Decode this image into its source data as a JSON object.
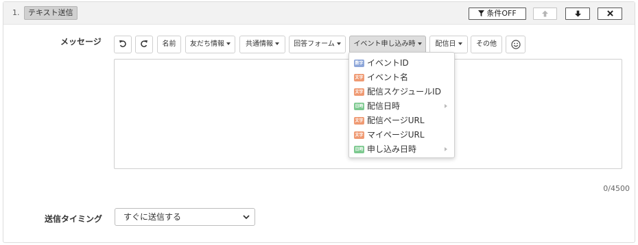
{
  "step": {
    "number": "1.",
    "title": "テキスト送信"
  },
  "header_buttons": {
    "condition_label": "条件OFF",
    "move_up_label": "🡅",
    "move_down_label": "🡇",
    "delete_label": "✖"
  },
  "message": {
    "label": "メッセージ",
    "toolbar": {
      "undo_icon": "undo-icon",
      "redo_icon": "redo-icon",
      "name": "名前",
      "friend_info": "友だち情報",
      "common_info": "共通情報",
      "answer_form": "回答フォーム",
      "event_application": "イベント申し込み時",
      "delivery_date": "配信日",
      "other": "その他",
      "emoji_icon": "smile-icon"
    },
    "editor_value": "",
    "counter": "0/4500"
  },
  "dropdown": {
    "items": [
      {
        "tag": "数字",
        "tag_color": "#8da6d9",
        "label": "イベントID",
        "has_submenu": false
      },
      {
        "tag": "文字",
        "tag_color": "#ef9a73",
        "label": "イベント名",
        "has_submenu": false
      },
      {
        "tag": "文字",
        "tag_color": "#ef9a73",
        "label": "配信スケジュールID",
        "has_submenu": false
      },
      {
        "tag": "日時",
        "tag_color": "#7cc98f",
        "label": "配信日時",
        "has_submenu": true
      },
      {
        "tag": "文字",
        "tag_color": "#ef9a73",
        "label": "配信ページURL",
        "has_submenu": false
      },
      {
        "tag": "文字",
        "tag_color": "#ef9a73",
        "label": "マイページURL",
        "has_submenu": false
      },
      {
        "tag": "日時",
        "tag_color": "#7cc98f",
        "label": "申し込み日時",
        "has_submenu": true
      }
    ]
  },
  "timing": {
    "label": "送信タイミング",
    "selected": "すぐに送信する"
  }
}
